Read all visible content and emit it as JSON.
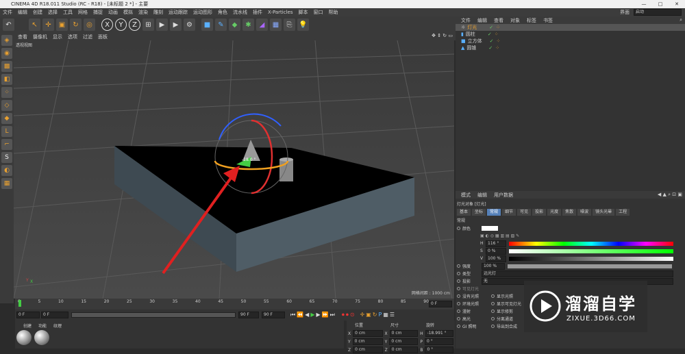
{
  "title": "CINEMA 4D R18.011 Studio (RC - R18) - [未标题 2 *] - 主要",
  "menu": [
    "文件",
    "编辑",
    "创建",
    "选择",
    "工具",
    "网格",
    "捕捉",
    "动画",
    "模拟",
    "渲染",
    "雕刻",
    "运动跟踪",
    "运动图形",
    "角色",
    "流水线",
    "插件",
    "X-Particles",
    "脚本",
    "窗口",
    "帮助"
  ],
  "layout": {
    "label": "界面",
    "value": "启动"
  },
  "viewport": {
    "menu": [
      "查看",
      "摄像机",
      "显示",
      "选项",
      "过滤",
      "面板"
    ],
    "label": "透视视图",
    "grid_text": "网格间距 : 1000 cm",
    "angle_label": "-18.0 °"
  },
  "timeline": {
    "ticks": [
      "0",
      "5",
      "10",
      "15",
      "20",
      "25",
      "30",
      "35",
      "40",
      "45",
      "50",
      "55",
      "60",
      "65",
      "70",
      "75",
      "80",
      "85",
      "90"
    ],
    "end": "0 F"
  },
  "transport": {
    "start": "0 F",
    "current": "0 F",
    "min_field": "90 F",
    "max_field": "90 F"
  },
  "materials": {
    "menu": [
      "创建",
      "功能",
      "纹理"
    ]
  },
  "coords": {
    "headers": [
      "位置",
      "尺寸",
      "旋转"
    ],
    "rows": [
      {
        "axis": "X",
        "pos": "0 cm",
        "size": "0 cm",
        "rot_label": "H",
        "rot": "-18.991 °"
      },
      {
        "axis": "Y",
        "pos": "0 cm",
        "size": "0 cm",
        "rot_label": "P",
        "rot": "0 °"
      },
      {
        "axis": "Z",
        "pos": "0 cm",
        "size": "0 cm",
        "rot_label": "B",
        "rot": "0 °"
      }
    ]
  },
  "objects": {
    "menu": [
      "文件",
      "编辑",
      "查看",
      "对象",
      "标签",
      "书签"
    ],
    "items": [
      {
        "name": "灯光"
      },
      {
        "name": "圆柱"
      },
      {
        "name": "立方体"
      },
      {
        "name": "圆锥"
      }
    ]
  },
  "attributes": {
    "menu": [
      "模式",
      "编辑",
      "用户数据"
    ],
    "object_title": "灯光对象 [灯光]",
    "tabs": [
      "基本",
      "坐标",
      "常规",
      "细节",
      "可见",
      "投影",
      "光度",
      "焦散",
      "噪波",
      "镜头光晕",
      "工程"
    ],
    "active_tab": "常规",
    "section": "常规",
    "color_label": "颜色",
    "hsv": [
      {
        "k": "H",
        "v": "116 °"
      },
      {
        "k": "S",
        "v": "0 %"
      },
      {
        "k": "V",
        "v": "100 %"
      }
    ],
    "intensity_label": "强度",
    "intensity": "100 %",
    "type_label": "类型",
    "type": "远光灯",
    "shadow_label": "投影",
    "shadow": "无",
    "visible_label": "可见灯光",
    "checks_left": [
      "没有光照",
      "环境光照",
      "漫射",
      "高光",
      "GI 照明"
    ],
    "checks_right": [
      "显示光照",
      "显示可见灯光",
      "显示修剪",
      "分离通道",
      "导出到合成"
    ]
  },
  "watermark": {
    "title": "溜溜自学",
    "url": "ZIXUE.3D66.COM"
  },
  "colors": {
    "selection": "#5580b8",
    "accent": "#e8a030",
    "arrow": "#e02020"
  }
}
